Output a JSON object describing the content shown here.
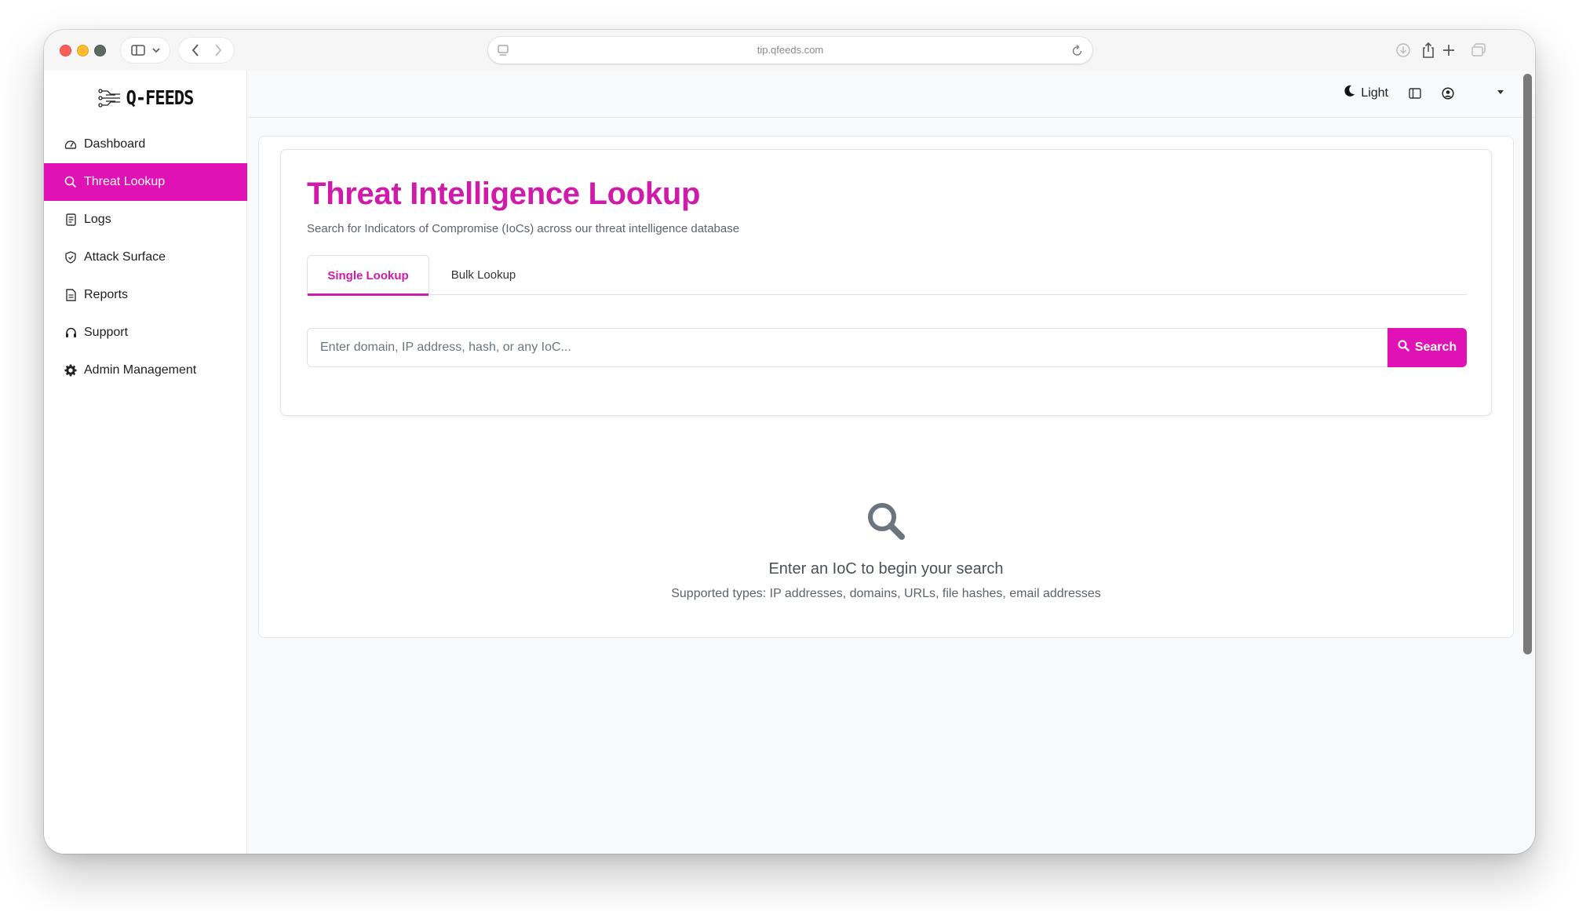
{
  "browser": {
    "url": "tip.qfeeds.com",
    "icons": [
      "sidebar-toggle-icon",
      "chevron-down-icon",
      "back-icon",
      "forward-icon",
      "site-settings-icon",
      "reload-icon",
      "download-icon",
      "share-icon",
      "new-tab-icon",
      "tab-overview-icon"
    ]
  },
  "brand": {
    "name": "Q-FEEDS"
  },
  "sidebar": {
    "items": [
      {
        "label": "Dashboard",
        "icon": "gauge-icon",
        "active": false
      },
      {
        "label": "Threat Lookup",
        "icon": "search-icon",
        "active": true
      },
      {
        "label": "Logs",
        "icon": "log-file-icon",
        "active": false
      },
      {
        "label": "Attack Surface",
        "icon": "shield-icon",
        "active": false
      },
      {
        "label": "Reports",
        "icon": "report-file-icon",
        "active": false
      },
      {
        "label": "Support",
        "icon": "headset-icon",
        "active": false
      },
      {
        "label": "Admin Management",
        "icon": "gear-icon",
        "active": false
      }
    ]
  },
  "header": {
    "theme_label": "Light",
    "icons": [
      "moon-icon",
      "layout-toggle-icon",
      "user-icon",
      "caret-down-icon"
    ]
  },
  "main": {
    "title": "Threat Intelligence Lookup",
    "subtitle": "Search for Indicators of Compromise (IoCs) across our threat intelligence database",
    "tabs": [
      {
        "label": "Single Lookup",
        "active": true
      },
      {
        "label": "Bulk Lookup",
        "active": false
      }
    ],
    "search": {
      "placeholder": "Enter domain, IP address, hash, or any IoC...",
      "value": "",
      "button_label": "Search"
    },
    "empty_state": {
      "title": "Enter an IoC to begin your search",
      "subtitle": "Supported types: IP addresses, domains, URLs, file hashes, email addresses"
    }
  },
  "colors": {
    "accent": "#e011b5",
    "title": "#d01aaa",
    "muted_text": "#5c636a",
    "background": "#f8f9fa"
  }
}
